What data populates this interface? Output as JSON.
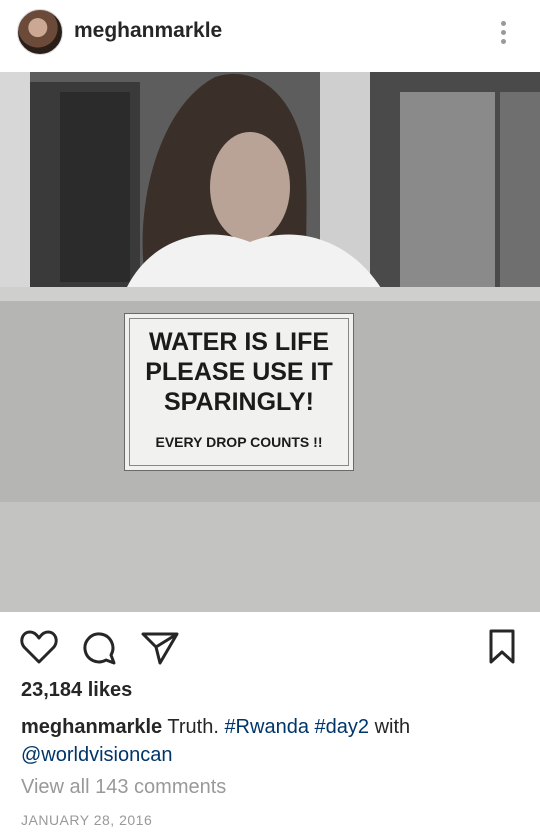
{
  "post": {
    "username": "meghanmarkle",
    "likes": "23,184 likes",
    "caption": {
      "username": "meghanmarkle",
      "text_before": "Truth.",
      "hashtag1": "#Rwanda",
      "hashtag2": "#day2",
      "text_mid": "with",
      "mention": "@worldvisioncan"
    },
    "view_comments": "View all 143 comments",
    "date": "JANUARY 28, 2016"
  },
  "sign": {
    "line1": "WATER IS LIFE",
    "line2": "PLEASE USE IT",
    "line3": "SPARINGLY!",
    "line4": "EVERY DROP COUNTS !!"
  },
  "icons": {
    "more": "more-vertical-icon",
    "like": "heart-icon",
    "comment": "comment-bubble-icon",
    "share": "paper-plane-icon",
    "save": "bookmark-icon"
  },
  "colors": {
    "text": "#262626",
    "secondary": "#999999",
    "link": "#003569"
  }
}
